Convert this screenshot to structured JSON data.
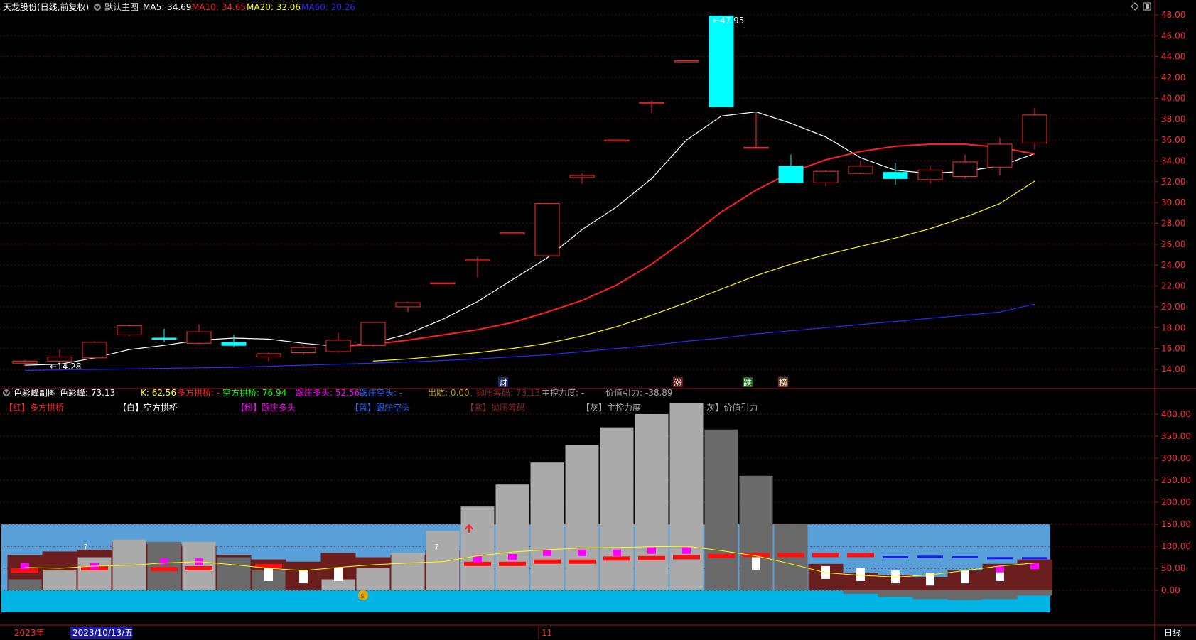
{
  "header": {
    "stock_title": "天龙股份(日线,前复权)",
    "main_indicator": "默认主图",
    "ma_labels": [
      {
        "text": "MA5: 34.69",
        "color": "#ffffff"
      },
      {
        "text": "MA10: 34.65",
        "color": "#ff2020"
      },
      {
        "text": "MA20: 32.06",
        "color": "#ffff00"
      },
      {
        "text": "MA60: 20.26",
        "color": "#2a2aff"
      }
    ]
  },
  "sub_header": {
    "indicator_name": "色彩峰副图",
    "items": [
      {
        "text": "色彩峰: 73.13",
        "color": "#ffffff"
      },
      {
        "text": "K: 62.56",
        "color": "#ffff00"
      },
      {
        "text": "多方拱桥: -",
        "color": "#ff2020"
      },
      {
        "text": "空方拱桥: 76.94",
        "color": "#00ff00"
      },
      {
        "text": "跟庄多头: 52.56",
        "color": "#ff00ff"
      },
      {
        "text": "跟庄空头: -",
        "color": "#2a6aff"
      },
      {
        "text": "出肮: 0.00",
        "color": "#c0a000"
      },
      {
        "text": "抛压筹码: 73.13",
        "color": "#8a2a2a"
      },
      {
        "text": "主控力度: -",
        "color": "#aaaaaa"
      },
      {
        "text": "价值引力: -38.89",
        "color": "#aaaaaa"
      }
    ],
    "legend": [
      {
        "text": "【红】多方拱桥",
        "color": "#ff2020"
      },
      {
        "text": "【白】空方拱桥",
        "color": "#ffffff"
      },
      {
        "text": "【粉】跟庄多头",
        "color": "#ff00ff"
      },
      {
        "text": "【蓝】跟庄空头",
        "color": "#2a6aff"
      },
      {
        "text": "【紫】抛压筹码",
        "color": "#8a2a2a"
      },
      {
        "text": "【灰】主控力度",
        "color": "#aaaaaa"
      },
      {
        "text": "【-灰】价值引力",
        "color": "#aaaaaa"
      }
    ]
  },
  "markers": {
    "low_label": "14.28",
    "high_label": "47.95",
    "events": [
      {
        "text": "财",
        "color": "#ffffff",
        "bg": "#1a2a6a"
      },
      {
        "text": "涨",
        "color": "#ffffff",
        "bg": "#6a1a1a"
      },
      {
        "text": "跌",
        "color": "#ffffff",
        "bg": "#1a6a1a"
      },
      {
        "text": "榜",
        "color": "#ffffff",
        "bg": "#6a3a1a"
      }
    ]
  },
  "footer": {
    "year": "2023年",
    "cursor_date": "2023/10/13/五",
    "month_mark": "11",
    "period": "日线"
  },
  "icons": [
    "collapse-icon",
    "diamond-icon",
    "restore-icon",
    "money-bag-icon",
    "up-arrow-icon"
  ],
  "chart_data": [
    {
      "type": "candlestick",
      "name": "天龙股份 日线",
      "ylim": [
        13,
        49
      ],
      "y_ticks": [
        "14.00",
        "16.00",
        "18.00",
        "20.00",
        "22.00",
        "24.00",
        "26.00",
        "28.00",
        "30.00",
        "32.00",
        "34.00",
        "36.00",
        "38.00",
        "40.00",
        "42.00",
        "44.00",
        "46.00",
        "48.00"
      ],
      "candles": [
        {
          "o": 14.6,
          "h": 14.9,
          "l": 14.3,
          "c": 14.8
        },
        {
          "o": 14.8,
          "h": 15.9,
          "l": 14.6,
          "c": 15.2
        },
        {
          "o": 15.1,
          "h": 16.7,
          "l": 15.0,
          "c": 16.6
        },
        {
          "o": 17.3,
          "h": 18.3,
          "l": 17.2,
          "c": 18.2
        },
        {
          "o": 17.0,
          "h": 17.9,
          "l": 16.6,
          "c": 16.9
        },
        {
          "o": 16.5,
          "h": 18.3,
          "l": 16.4,
          "c": 17.6
        },
        {
          "o": 16.6,
          "h": 17.3,
          "l": 16.1,
          "c": 16.3
        },
        {
          "o": 15.2,
          "h": 15.6,
          "l": 14.8,
          "c": 15.5
        },
        {
          "o": 15.6,
          "h": 16.3,
          "l": 15.4,
          "c": 16.1
        },
        {
          "o": 15.7,
          "h": 17.5,
          "l": 15.6,
          "c": 16.8
        },
        {
          "o": 16.3,
          "h": 18.5,
          "l": 16.2,
          "c": 18.5
        },
        {
          "o": 20.0,
          "h": 20.5,
          "l": 19.5,
          "c": 20.4
        },
        {
          "o": 22.3,
          "h": 22.3,
          "l": 22.3,
          "c": 22.3
        },
        {
          "o": 24.5,
          "h": 24.8,
          "l": 22.8,
          "c": 24.5
        },
        {
          "o": 27.1,
          "h": 27.1,
          "l": 27.1,
          "c": 27.1
        },
        {
          "o": 24.9,
          "h": 29.9,
          "l": 24.8,
          "c": 29.9
        },
        {
          "o": 32.4,
          "h": 32.8,
          "l": 31.8,
          "c": 32.6
        },
        {
          "o": 36.0,
          "h": 36.0,
          "l": 36.0,
          "c": 36.0
        },
        {
          "o": 39.6,
          "h": 39.8,
          "l": 38.6,
          "c": 39.6
        },
        {
          "o": 43.6,
          "h": 43.6,
          "l": 43.6,
          "c": 43.6
        },
        {
          "o": 47.9,
          "h": 47.95,
          "l": 39.2,
          "c": 39.2
        },
        {
          "o": 35.3,
          "h": 38.6,
          "l": 35.2,
          "c": 35.3
        },
        {
          "o": 33.5,
          "h": 34.6,
          "l": 31.9,
          "c": 31.9
        },
        {
          "o": 31.9,
          "h": 33.1,
          "l": 31.6,
          "c": 33.0
        },
        {
          "o": 32.8,
          "h": 34.0,
          "l": 32.7,
          "c": 33.5
        },
        {
          "o": 32.9,
          "h": 33.8,
          "l": 31.7,
          "c": 32.3
        },
        {
          "o": 32.2,
          "h": 33.5,
          "l": 31.8,
          "c": 33.1
        },
        {
          "o": 32.5,
          "h": 34.6,
          "l": 32.3,
          "c": 33.9
        },
        {
          "o": 33.4,
          "h": 36.2,
          "l": 32.6,
          "c": 35.6
        },
        {
          "o": 35.7,
          "h": 39.1,
          "l": 35.1,
          "c": 38.4
        }
      ],
      "ma_series": [
        {
          "name": "MA5",
          "color": "#ffffff",
          "values": [
            14.4,
            14.5,
            15.1,
            15.9,
            16.3,
            16.8,
            17.0,
            16.9,
            16.5,
            16.2,
            16.5,
            17.4,
            18.8,
            20.5,
            22.6,
            24.7,
            27.4,
            29.6,
            32.3,
            36.0,
            38.3,
            38.7,
            37.6,
            36.3,
            34.3,
            33.1,
            32.8,
            33.0,
            33.5,
            34.69
          ]
        },
        {
          "name": "MA10",
          "color": "#ff2020",
          "values": [
            null,
            null,
            null,
            null,
            null,
            null,
            null,
            null,
            null,
            16.2,
            16.4,
            16.8,
            17.3,
            17.8,
            18.5,
            19.5,
            20.6,
            22.1,
            24.1,
            26.5,
            29.1,
            31.2,
            32.9,
            34.1,
            34.9,
            35.4,
            35.6,
            35.6,
            35.3,
            34.65
          ]
        },
        {
          "name": "MA20",
          "color": "#ffff00",
          "values": [
            null,
            null,
            null,
            null,
            null,
            null,
            null,
            null,
            null,
            null,
            14.8,
            15.0,
            15.3,
            15.6,
            16.0,
            16.5,
            17.2,
            18.1,
            19.2,
            20.4,
            21.7,
            23.0,
            24.1,
            25.0,
            25.8,
            26.6,
            27.5,
            28.6,
            29.9,
            32.06
          ]
        },
        {
          "name": "MA60",
          "color": "#2a2aff",
          "values": [
            13.9,
            13.95,
            14.0,
            14.05,
            14.1,
            14.15,
            14.2,
            14.3,
            14.4,
            14.5,
            14.6,
            14.7,
            14.85,
            15.0,
            15.2,
            15.4,
            15.7,
            16.0,
            16.3,
            16.7,
            17.0,
            17.4,
            17.7,
            18.0,
            18.3,
            18.6,
            18.9,
            19.2,
            19.5,
            20.26
          ]
        }
      ]
    },
    {
      "type": "bar",
      "name": "色彩峰副图",
      "ylim": [
        -50,
        440
      ],
      "y_ticks": [
        "0.00",
        "50.00",
        "100.00",
        "150.00",
        "200.00",
        "250.00",
        "300.00",
        "350.00",
        "400.00"
      ],
      "zones": {
        "sky_top": 150,
        "cyan_bottom": -50
      },
      "gray_light": [
        0,
        45,
        75,
        115,
        0,
        110,
        0,
        0,
        0,
        25,
        50,
        85,
        135,
        190,
        240,
        290,
        330,
        370,
        400,
        425,
        0,
        0,
        0,
        0,
        0,
        0,
        0,
        0,
        0,
        0
      ],
      "gray_dark": [
        25,
        0,
        0,
        0,
        110,
        0,
        75,
        45,
        0,
        0,
        0,
        0,
        0,
        0,
        0,
        0,
        0,
        0,
        0,
        0,
        365,
        260,
        150,
        0,
        0,
        0,
        0,
        0,
        0,
        0
      ],
      "maroon": [
        80,
        88,
        92,
        110,
        105,
        100,
        80,
        70,
        65,
        85,
        75,
        80,
        90,
        0,
        0,
        0,
        0,
        0,
        0,
        0,
        0,
        0,
        0,
        60,
        40,
        35,
        30,
        45,
        60,
        70
      ],
      "neg_gray": [
        0,
        0,
        0,
        0,
        0,
        0,
        0,
        0,
        0,
        0,
        0,
        0,
        0,
        0,
        0,
        0,
        0,
        0,
        0,
        0,
        0,
        0,
        0,
        0,
        -8,
        -15,
        -20,
        -22,
        -20,
        -12
      ],
      "k_line": [
        52,
        50,
        55,
        57,
        62,
        65,
        58,
        50,
        45,
        52,
        58,
        62,
        65,
        78,
        87,
        92,
        96,
        97,
        99,
        100,
        90,
        78,
        60,
        40,
        34,
        30,
        35,
        45,
        55,
        62
      ],
      "pink": [
        55,
        0,
        55,
        0,
        65,
        65,
        0,
        0,
        0,
        0,
        0,
        0,
        0,
        70,
        75,
        85,
        85,
        85,
        90,
        90,
        0,
        0,
        0,
        0,
        0,
        0,
        0,
        0,
        48,
        55
      ],
      "red_bars": [
        45,
        0,
        50,
        0,
        48,
        50,
        0,
        55,
        0,
        0,
        0,
        0,
        0,
        60,
        60,
        65,
        65,
        72,
        73,
        75,
        78,
        80,
        80,
        80,
        80,
        0,
        0,
        0,
        0,
        0
      ],
      "white_bars": [
        0,
        0,
        0,
        0,
        0,
        0,
        0,
        50,
        45,
        50,
        0,
        0,
        0,
        0,
        0,
        0,
        0,
        0,
        0,
        0,
        0,
        75,
        0,
        55,
        50,
        45,
        40,
        45,
        50,
        0
      ],
      "blue_bars": [
        0,
        0,
        0,
        0,
        0,
        0,
        0,
        0,
        0,
        0,
        0,
        0,
        0,
        0,
        0,
        0,
        0,
        0,
        0,
        0,
        0,
        0,
        0,
        0,
        0,
        75,
        76,
        75,
        73,
        73
      ]
    }
  ]
}
